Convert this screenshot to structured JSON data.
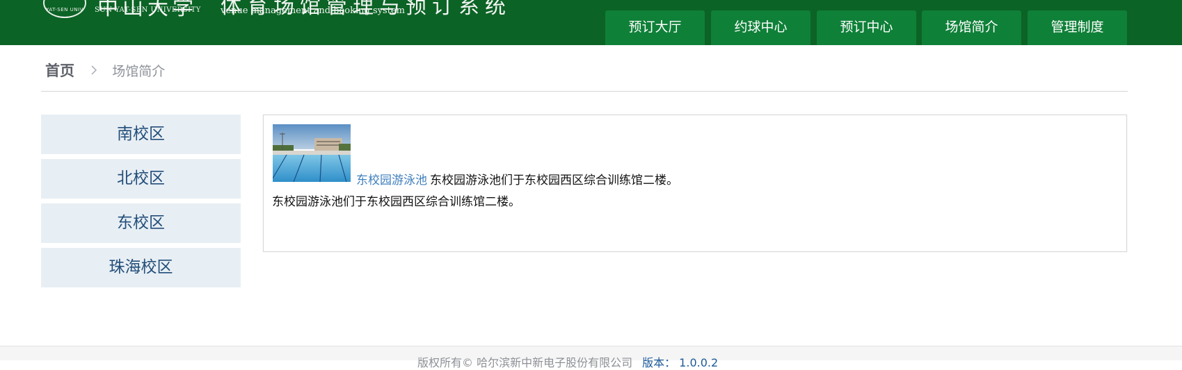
{
  "header": {
    "logo_cn": "中山大学",
    "logo_en": "SUN YAT-SEN UNIVERSITY",
    "seal_text": "YAT-SEN UNIV",
    "system_cn": "体育场馆管理与预订系统",
    "system_en": "venue management and booking system",
    "nav": [
      {
        "label": "预订大厅"
      },
      {
        "label": "约球中心"
      },
      {
        "label": "预订中心"
      },
      {
        "label": "场馆简介"
      },
      {
        "label": "管理制度"
      }
    ]
  },
  "breadcrumb": {
    "home": "首页",
    "separator": ">",
    "current": "场馆简介"
  },
  "sidebar": {
    "campuses": [
      {
        "label": "南校区"
      },
      {
        "label": "北校区"
      },
      {
        "label": "东校区"
      },
      {
        "label": "珠海校区"
      }
    ]
  },
  "venue": {
    "name": "东校园游泳池",
    "summary": "东校园游泳池们于东校园西区综合训练馆二楼。",
    "description": "东校园游泳池们于东校园西区综合训练馆二楼。"
  },
  "footer": {
    "copyright": "版权所有© 哈尔滨新中新电子股份有限公司",
    "version_label": "版本： 1.0.0.2"
  },
  "colors": {
    "header_bg": "#0b6325",
    "nav_bg": "#0f8038",
    "sidebar_bg": "#e8eff4",
    "link": "#3f7fbe"
  }
}
